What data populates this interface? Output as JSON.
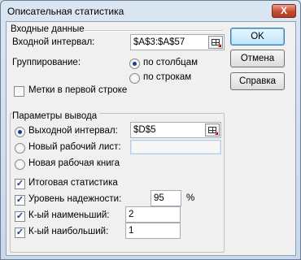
{
  "window": {
    "title": "Описательная статистика",
    "close_glyph": "X"
  },
  "input_section": {
    "header": "Входные данные",
    "input_range_label": "Входной интервал:",
    "input_range_value": "$A$3:$A$57",
    "grouping_label": "Группирование:",
    "grouping_options": [
      {
        "label": "по столбцам",
        "selected": true
      },
      {
        "label": "по строкам",
        "selected": false
      }
    ],
    "labels_first_row": {
      "label": "Метки в первой строке",
      "checked": false
    }
  },
  "output_section": {
    "header": "Параметры вывода",
    "output_options": [
      {
        "label": "Выходной интервал:",
        "selected": true,
        "value": "$D$5"
      },
      {
        "label": "Новый рабочий лист:",
        "selected": false,
        "value": ""
      },
      {
        "label": "Новая рабочая книга",
        "selected": false
      }
    ],
    "summary_statistics": {
      "label": "Итоговая статистика",
      "checked": true
    },
    "confidence_level": {
      "label": "Уровень надежности:",
      "checked": true,
      "value": "95",
      "unit": "%"
    },
    "kth_smallest": {
      "label": "К-ый наименьший:",
      "checked": true,
      "value": "2"
    },
    "kth_largest": {
      "label": "К-ый наибольший:",
      "checked": true,
      "value": "1"
    }
  },
  "buttons": {
    "ok": "OK",
    "cancel": "Отмена",
    "help": "Справка"
  },
  "icons": {
    "range_picker": "range-select-icon",
    "check_glyph": "✓"
  }
}
